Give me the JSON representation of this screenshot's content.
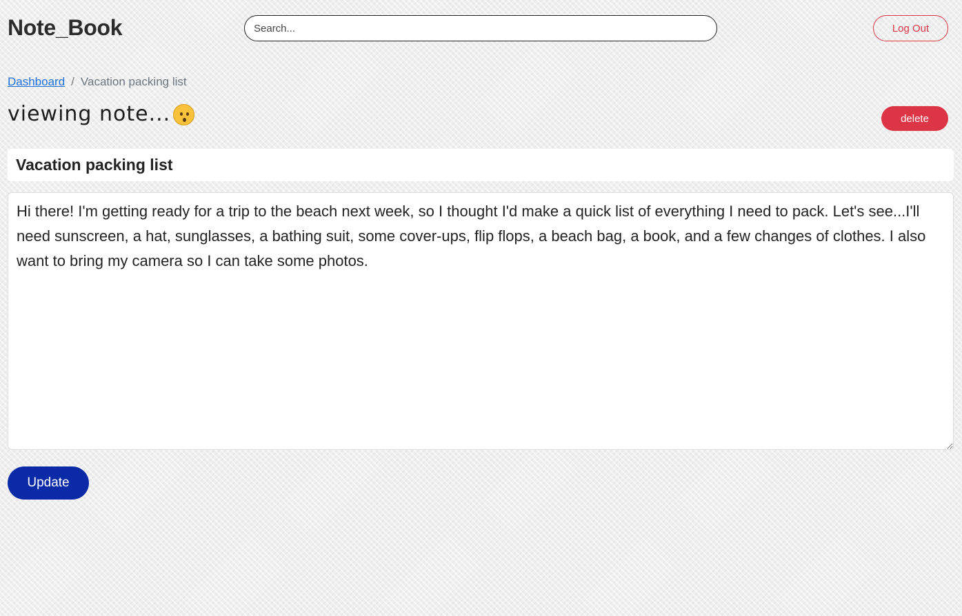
{
  "header": {
    "brand": "Note_Book",
    "search_placeholder": "Search...",
    "logout_label": "Log Out"
  },
  "breadcrumb": {
    "home": "Dashboard",
    "separator": "/",
    "current": "Vacation packing list"
  },
  "page": {
    "heading": "viewing note...",
    "emoji_icon": "hushed-face-icon",
    "delete_label": "delete"
  },
  "note": {
    "title": "Vacation packing list",
    "content": "Hi there! I'm getting ready for a trip to the beach next week, so I thought I'd make a quick list of everything I need to pack. Let's see...I'll need sunscreen, a hat, sunglasses, a bathing suit, some cover-ups, flip flops, a beach bag, a book, and a few changes of clothes. I also want to bring my camera so I can take some photos."
  },
  "actions": {
    "update_label": "Update"
  },
  "colors": {
    "danger": "#dc3545",
    "primary": "#0a2aa8",
    "link": "#1a6fe0"
  }
}
